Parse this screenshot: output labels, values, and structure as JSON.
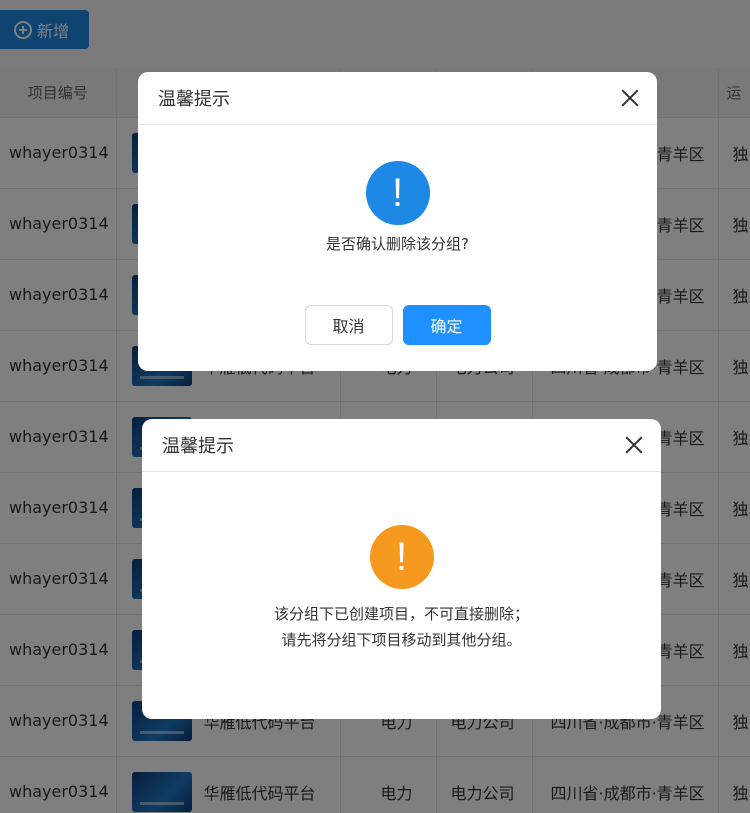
{
  "toolbar": {
    "add_label": "新增"
  },
  "table": {
    "headers": [
      "项目编号",
      "",
      "",
      "",
      "",
      "运"
    ],
    "rows": [
      {
        "code": "whayer0314",
        "name": "华雁低代码平台",
        "industry": "电力",
        "company": "电力公司",
        "region": "四川省·成都市·青羊区",
        "op": "独"
      },
      {
        "code": "whayer0314",
        "name": "华雁低代码平台",
        "industry": "电力",
        "company": "电力公司",
        "region": "四川省·成都市·青羊区",
        "op": "独"
      },
      {
        "code": "whayer0314",
        "name": "华雁低代码平台",
        "industry": "电力",
        "company": "电力公司",
        "region": "四川省·成都市·青羊区",
        "op": "独"
      },
      {
        "code": "whayer0314",
        "name": "华雁低代码平台",
        "industry": "电力",
        "company": "电力公司",
        "region": "四川省·成都市·青羊区",
        "op": "独"
      },
      {
        "code": "whayer0314",
        "name": "华雁低代码平台",
        "industry": "电力",
        "company": "电力公司",
        "region": "四川省·成都市·青羊区",
        "op": "独"
      },
      {
        "code": "whayer0314",
        "name": "华雁低代码平台",
        "industry": "电力",
        "company": "电力公司",
        "region": "四川省·成都市·青羊区",
        "op": "独"
      },
      {
        "code": "whayer0314",
        "name": "华雁低代码平台",
        "industry": "电力",
        "company": "电力公司",
        "region": "四川省·成都市·青羊区",
        "op": "独"
      },
      {
        "code": "whayer0314",
        "name": "华雁低代码平台",
        "industry": "电力",
        "company": "电力公司",
        "region": "四川省·成都市·青羊区",
        "op": "独"
      },
      {
        "code": "whayer0314",
        "name": "华雁低代码平台",
        "industry": "电力",
        "company": "电力公司",
        "region": "四川省·成都市·青羊区",
        "op": "独"
      },
      {
        "code": "whayer0314",
        "name": "华雁低代码平台",
        "industry": "电力",
        "company": "电力公司",
        "region": "四川省·成都市·青羊区",
        "op": "独"
      }
    ]
  },
  "dialog_confirm": {
    "title": "温馨提示",
    "icon": "exclamation-icon",
    "icon_color": "#1e88e5",
    "message": "是否确认删除该分组?",
    "cancel_label": "取消",
    "ok_label": "确定"
  },
  "dialog_warning": {
    "title": "温馨提示",
    "icon": "exclamation-icon",
    "icon_color": "#f59a1f",
    "message_line1": "该分组下已创建项目，不可直接删除；",
    "message_line2": "请先将分组下项目移动到其他分组。"
  }
}
